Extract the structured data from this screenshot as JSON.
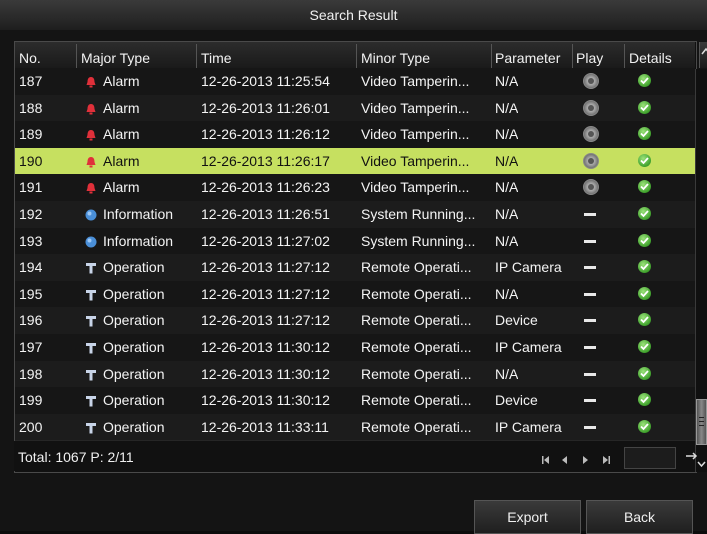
{
  "window": {
    "title": "Search Result"
  },
  "columns": {
    "no": "No.",
    "major_type": "Major Type",
    "time": "Time",
    "minor_type": "Minor Type",
    "parameter": "Parameter",
    "play": "Play",
    "details": "Details"
  },
  "rows": [
    {
      "no": "187",
      "major_type": "Alarm",
      "type_icon": "alarm-icon",
      "time": "12-26-2013 11:25:54",
      "minor_type": "Video Tamperin...",
      "parameter": "N/A",
      "play": "play-icon",
      "details": "check-icon"
    },
    {
      "no": "188",
      "major_type": "Alarm",
      "type_icon": "alarm-icon",
      "time": "12-26-2013 11:26:01",
      "minor_type": "Video Tamperin...",
      "parameter": "N/A",
      "play": "play-icon",
      "details": "check-icon"
    },
    {
      "no": "189",
      "major_type": "Alarm",
      "type_icon": "alarm-icon",
      "time": "12-26-2013 11:26:12",
      "minor_type": "Video Tamperin...",
      "parameter": "N/A",
      "play": "play-icon",
      "details": "check-icon"
    },
    {
      "no": "190",
      "major_type": "Alarm",
      "type_icon": "alarm-icon",
      "time": "12-26-2013 11:26:17",
      "minor_type": "Video Tamperin...",
      "parameter": "N/A",
      "play": "play-icon",
      "details": "check-icon",
      "selected": true
    },
    {
      "no": "191",
      "major_type": "Alarm",
      "type_icon": "alarm-icon",
      "time": "12-26-2013 11:26:23",
      "minor_type": "Video Tamperin...",
      "parameter": "N/A",
      "play": "play-icon",
      "details": "check-icon"
    },
    {
      "no": "192",
      "major_type": "Information",
      "type_icon": "information-icon",
      "time": "12-26-2013 11:26:51",
      "minor_type": "System Running...",
      "parameter": "N/A",
      "play": "dash-icon",
      "details": "check-icon"
    },
    {
      "no": "193",
      "major_type": "Information",
      "type_icon": "information-icon",
      "time": "12-26-2013 11:27:02",
      "minor_type": "System Running...",
      "parameter": "N/A",
      "play": "dash-icon",
      "details": "check-icon"
    },
    {
      "no": "194",
      "major_type": "Operation",
      "type_icon": "operation-icon",
      "time": "12-26-2013 11:27:12",
      "minor_type": "Remote Operati...",
      "parameter": "IP Camera",
      "play": "dash-icon",
      "details": "check-icon"
    },
    {
      "no": "195",
      "major_type": "Operation",
      "type_icon": "operation-icon",
      "time": "12-26-2013 11:27:12",
      "minor_type": "Remote Operati...",
      "parameter": "N/A",
      "play": "dash-icon",
      "details": "check-icon"
    },
    {
      "no": "196",
      "major_type": "Operation",
      "type_icon": "operation-icon",
      "time": "12-26-2013 11:27:12",
      "minor_type": "Remote Operati...",
      "parameter": "Device",
      "play": "dash-icon",
      "details": "check-icon"
    },
    {
      "no": "197",
      "major_type": "Operation",
      "type_icon": "operation-icon",
      "time": "12-26-2013 11:30:12",
      "minor_type": "Remote Operati...",
      "parameter": "IP Camera",
      "play": "dash-icon",
      "details": "check-icon"
    },
    {
      "no": "198",
      "major_type": "Operation",
      "type_icon": "operation-icon",
      "time": "12-26-2013 11:30:12",
      "minor_type": "Remote Operati...",
      "parameter": "N/A",
      "play": "dash-icon",
      "details": "check-icon"
    },
    {
      "no": "199",
      "major_type": "Operation",
      "type_icon": "operation-icon",
      "time": "12-26-2013 11:30:12",
      "minor_type": "Remote Operati...",
      "parameter": "Device",
      "play": "dash-icon",
      "details": "check-icon"
    },
    {
      "no": "200",
      "major_type": "Operation",
      "type_icon": "operation-icon",
      "time": "12-26-2013 11:33:11",
      "minor_type": "Remote Operati...",
      "parameter": "IP Camera",
      "play": "dash-icon",
      "details": "check-icon"
    }
  ],
  "footer": {
    "total_label": "Total: 1067  P: 2/11",
    "pager_icons": [
      "first-page-icon",
      "prev-page-icon",
      "next-page-icon",
      "last-page-icon"
    ],
    "go_icon": "go-arrow-icon"
  },
  "buttons": {
    "export": "Export",
    "back": "Back"
  },
  "colors": {
    "selected_row": "#c6e060",
    "alarm": "#e0303a",
    "information": "#4a8fd8",
    "operation": "#c8d4e8",
    "check": "#3fa12c"
  }
}
